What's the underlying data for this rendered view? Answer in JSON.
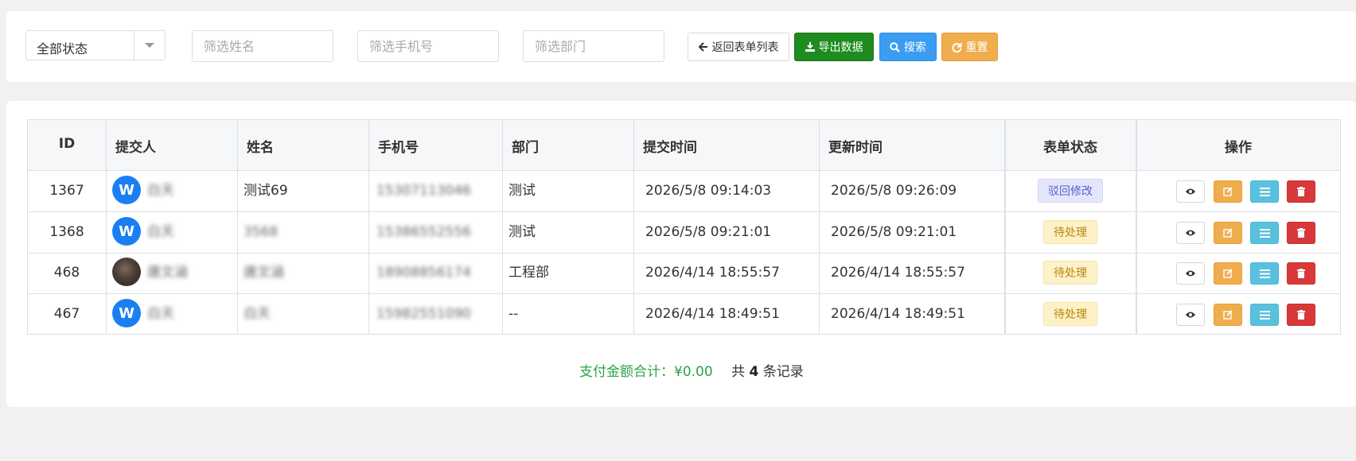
{
  "filters": {
    "status_select": "全部状态",
    "name_placeholder": "筛选姓名",
    "phone_placeholder": "筛选手机号",
    "dept_placeholder": "筛选部门"
  },
  "buttons": {
    "back": "返回表单列表",
    "export": "导出数据",
    "search": "搜索",
    "reset": "重置"
  },
  "table": {
    "headers": {
      "id": "ID",
      "submitter": "提交人",
      "name": "姓名",
      "phone": "手机号",
      "dept": "部门",
      "submit_time": "提交时间",
      "update_time": "更新时间",
      "status": "表单状态",
      "actions": "操作"
    },
    "rows": [
      {
        "id": "1367",
        "avatar": "W",
        "submitter": "白天",
        "name": "测试69",
        "phone": "15307113046",
        "dept": "测试",
        "submit_time": "2026/5/8 09:14:03",
        "update_time": "2026/5/8 09:26:09",
        "status": "驳回修改"
      },
      {
        "id": "1368",
        "avatar": "W",
        "submitter": "白天",
        "name": "3568",
        "phone": "15386552556",
        "dept": "测试",
        "submit_time": "2026/5/8 09:21:01",
        "update_time": "2026/5/8 09:21:01",
        "status": "待处理"
      },
      {
        "id": "468",
        "avatar": "",
        "submitter": "唐文涵",
        "name": "唐文涵",
        "phone": "18908856174",
        "dept": "工程部",
        "submit_time": "2026/4/14 18:55:57",
        "update_time": "2026/4/14 18:55:57",
        "status": "待处理"
      },
      {
        "id": "467",
        "avatar": "W",
        "submitter": "白天",
        "name": "白天",
        "phone": "15982551090",
        "dept": "--",
        "submit_time": "2026/4/14 18:49:51",
        "update_time": "2026/4/14 18:49:51",
        "status": "待处理"
      }
    ]
  },
  "summary": {
    "pay_label": "支付金额合计：",
    "pay_amount": "¥0.00",
    "total_prefix": "共",
    "total_count": "4",
    "total_suffix": "条记录"
  },
  "icons": {
    "back": "arrow-left-icon",
    "export": "download-icon",
    "search": "search-icon",
    "reset": "refresh-icon",
    "view": "eye-icon",
    "edit": "edit-icon",
    "list": "list-icon",
    "delete": "trash-icon"
  },
  "colors": {
    "export_button": "#1e8c1e",
    "search_button": "#3b9df2",
    "reset_button": "#f0ad4e",
    "delete_button": "#d9383b",
    "list_button": "#5bc0de",
    "pay_text": "#2aa349"
  }
}
